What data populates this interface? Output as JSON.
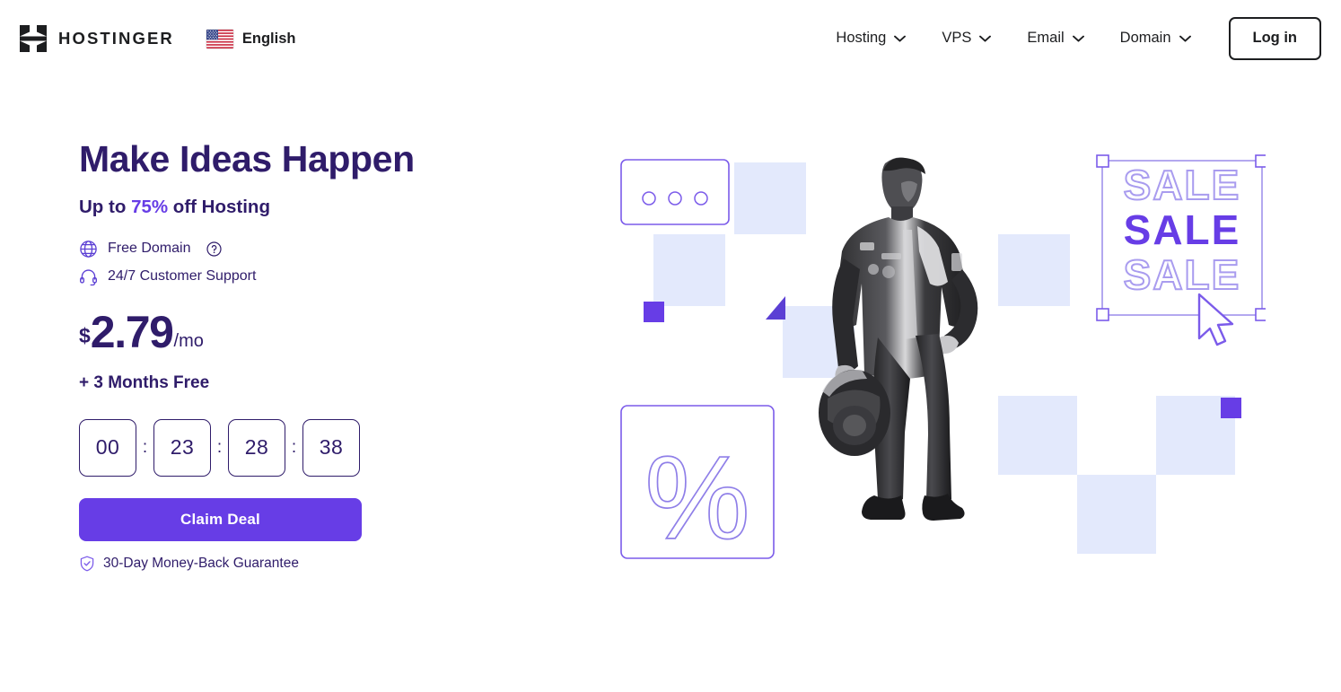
{
  "header": {
    "brand_name": "HOSTINGER",
    "logo_icon": "hostinger-h-logo",
    "language": {
      "label": "English",
      "flag": "us-flag-icon"
    },
    "nav": [
      {
        "label": "Hosting",
        "icon": "chevron-down-icon"
      },
      {
        "label": "VPS",
        "icon": "chevron-down-icon"
      },
      {
        "label": "Email",
        "icon": "chevron-down-icon"
      },
      {
        "label": "Domain",
        "icon": "chevron-down-icon"
      }
    ],
    "login_label": "Log in"
  },
  "hero": {
    "headline": "Make Ideas Happen",
    "subhead_prefix": "Up to ",
    "subhead_percent": "75%",
    "subhead_suffix": " off Hosting",
    "features": [
      {
        "label": "Free Domain",
        "icon": "globe-icon",
        "help_icon": "question-circle-icon"
      },
      {
        "label": "24/7 Customer Support",
        "icon": "headset-icon"
      }
    ],
    "price": {
      "currency": "$",
      "amount": "2.79",
      "period": "/mo"
    },
    "bonus": "+ 3 Months Free",
    "countdown": {
      "values": [
        "00",
        "23",
        "28",
        "38"
      ],
      "separator": ":"
    },
    "cta_label": "Claim Deal",
    "guarantee": {
      "label": "30-Day Money-Back Guarantee",
      "icon": "shield-check-icon"
    }
  },
  "illustration": {
    "sale_lines": [
      "SALE",
      "SALE",
      "SALE"
    ],
    "percent_glyph": "%",
    "dots_count": 3,
    "cursor_icon": "mouse-pointer-icon",
    "subject": "racing-driver-photo"
  },
  "colors": {
    "brand_purple": "#673DE6",
    "deep_purple": "#2F1C6A",
    "pale_blue": "#E3E9FC",
    "lilac_outline": "#9A8CEA",
    "ink": "#1D1E20"
  }
}
